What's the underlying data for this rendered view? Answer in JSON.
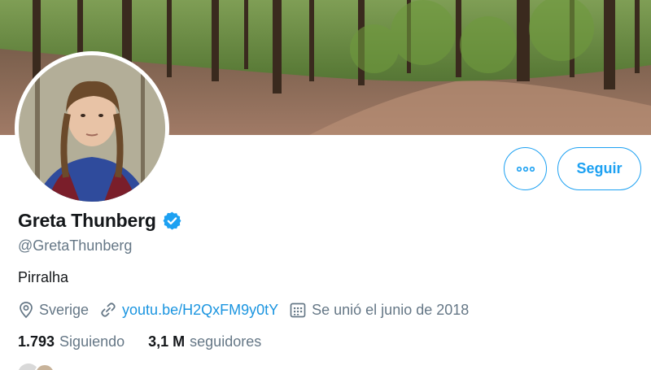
{
  "profile": {
    "name": "Greta Thunberg",
    "handle": "@GretaThunberg",
    "bio": "Pirralha",
    "location": "Sverige",
    "website": "youtu.be/H2QxFM9y0tY",
    "joined": "Se unió el junio de 2018",
    "verified": true
  },
  "actions": {
    "follow_label": "Seguir",
    "more_icon": "more-horizontal-icon"
  },
  "stats": {
    "following_count": "1.793",
    "following_label": "Siguiendo",
    "followers_count": "3,1 M",
    "followers_label": "seguidores"
  },
  "colors": {
    "accent": "#1da1f2",
    "link": "#1b95e0",
    "secondary_text": "#657786",
    "primary_text": "#14171a"
  }
}
